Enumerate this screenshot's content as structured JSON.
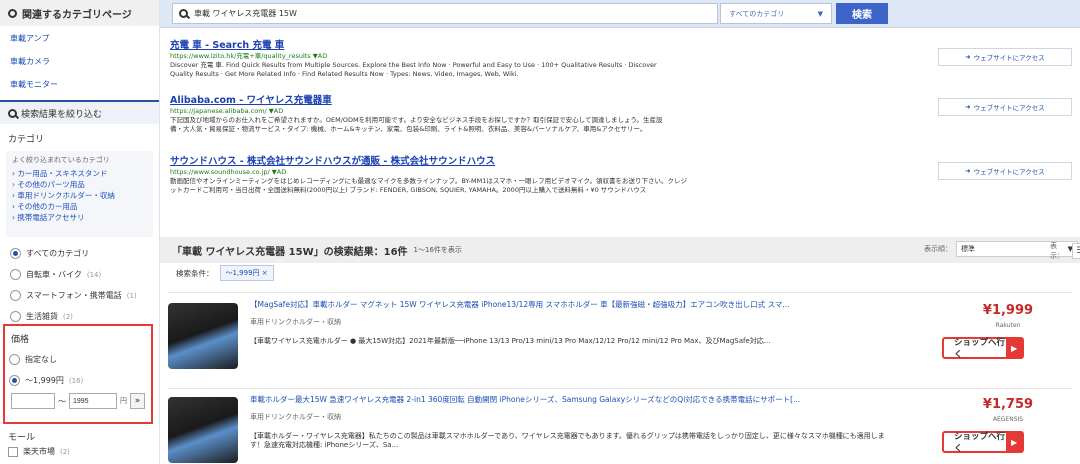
{
  "sidebar": {
    "related_heading": "関連するカテゴリページ",
    "related_links": [
      "車載アンプ",
      "車載カメラ",
      "車載モニター"
    ],
    "refine_heading": "検索結果を絞り込む",
    "category_title": "カテゴリ",
    "popular_label": "よく絞り込まれているカテゴリ",
    "popular_links": [
      "カー用品・スキネスタンド",
      "その他のパーツ用品",
      "車用ドリンクホルダー・収納",
      "その他のカー用品",
      "携帯電話アクセサリ"
    ],
    "category_radios": [
      {
        "label": "すべてのカテゴリ",
        "count": "",
        "checked": true
      },
      {
        "label": "自転車・バイク",
        "count": "(14)",
        "checked": false
      },
      {
        "label": "スマートフォン・携帯電話",
        "count": "(1)",
        "checked": false
      },
      {
        "label": "生活雑貨",
        "count": "(2)",
        "checked": false
      }
    ],
    "price": {
      "title": "価格",
      "options": [
        {
          "label": "指定なし",
          "count": "",
          "checked": false
        },
        {
          "label": "〜1,999円",
          "count": "(16)",
          "checked": true
        }
      ],
      "min_value": "",
      "tilde": "〜",
      "max_value": "1995",
      "unit": "円",
      "go": "»"
    },
    "mall_title": "モール",
    "mall_option": {
      "label": "楽天市場",
      "count": "(2)"
    }
  },
  "search": {
    "query": "車載 ワイヤレス充電器 15W",
    "category": "すべてのカテゴリ",
    "button": "検索"
  },
  "ads": [
    {
      "title": "充電 車 - Search 充電 車",
      "url": "https://www.izito.hk/充電+車/quality_results ▼AD",
      "desc": "Discover 充電 車. Find Quick Results from Multiple Sources. Explore the Best Info Now · Powerful and Easy to Use · 100+ Qualitative Results · Discover Quality Results · Get More Related Info · Find Related Results Now · Types: News, Video, Images, Web, Wiki.",
      "visit": "ウェブサイトにアクセス"
    },
    {
      "title": "Alibaba.com - ワイヤレス充電器車",
      "url": "https://japanese.alibaba.com/ ▼AD",
      "desc": "下記国及び地域からのお仕入れをご希望されますか。OEM/ODMを利用可能です。より安全なビジネス手段をお探しですか？取引保証で安心して調達しましょう。生産設備・大人気・貿易保証・物流サービス・タイプ: 機械、ホーム&キッチン、家電、包装&印刷、ライト&照明、衣料品、美容&パーソナルケア、車用&アクセサリー。",
      "visit": "ウェブサイトにアクセス"
    },
    {
      "title": "サウンドハウス - 株式会社サウンドハウスが通販 - 株式会社サウンドハウス",
      "url": "https://www.soundhouse.co.jp/ ▼AD",
      "desc": "動画配信やオンラインミーティングをはじめレコーディングにも最適なマイクを多数ラインナップ。BY-MM1はスマホ・一眼レフ用ビデオマイク。領収書をお送り下さい。クレジットカードご利用可・当日出荷・全国送料無料(2000円以上) ブランド: FENDER, GIBSON, SQUIER, YAMAHA。2000円以上購入で送料無料・¥0 サウンドハウス",
      "visit": "ウェブサイトにアクセス"
    }
  ],
  "results": {
    "title": "「車載 ワイヤレス充電器 15W」の検索結果：",
    "count": "16件",
    "range": "1〜16件を表示",
    "sort_label": "表示順：",
    "sort_value": "標準",
    "display_label": "表示：",
    "condition_label": "検索条件：",
    "condition_chip": "〜1,999円 ×"
  },
  "products": [
    {
      "title": "【MagSafe対応】車載ホルダー マグネット 15W ワイヤレス充電器 iPhone13/12専用 スマホホルダー 車【最新強磁・超強吸力】エアコン吹き出し口式 スマ...",
      "category": "車用ドリンクホルダー・収納",
      "desc": "【車載ワイヤレス充電ホルダー ● 最大15W対応】2021年最新版──iPhone 13/13 Pro/13 mini/13 Pro Max/12/12 Pro/12 mini/12 Pro Max、及びMagSafe対応...",
      "price": "¥1,999",
      "shop": "Rakuten",
      "button": "ショップへ行く"
    },
    {
      "title": "車載ホルダー最大15W 急速ワイヤレス充電器 2-in1 360度回転 自動開閉 iPhoneシリーズ、Samsung GalaxyシリーズなどのQi対応できる携帯電話にサポート[...",
      "category": "車用ドリンクホルダー・収納",
      "desc": "【車載ホルダー・ワイヤレス充電器】私たちのこの製品は車載スマホホルダーであり、ワイヤレス充電器でもあります。優れるグリップは携帯電話をしっかり固定し、更に様々なスマホ機種にも適用します！急速充電対応機種: iPhoneシリーズ、Sa...",
      "price": "¥1,759",
      "shop": "AEGENSIS",
      "button": "ショップへ行く"
    }
  ]
}
